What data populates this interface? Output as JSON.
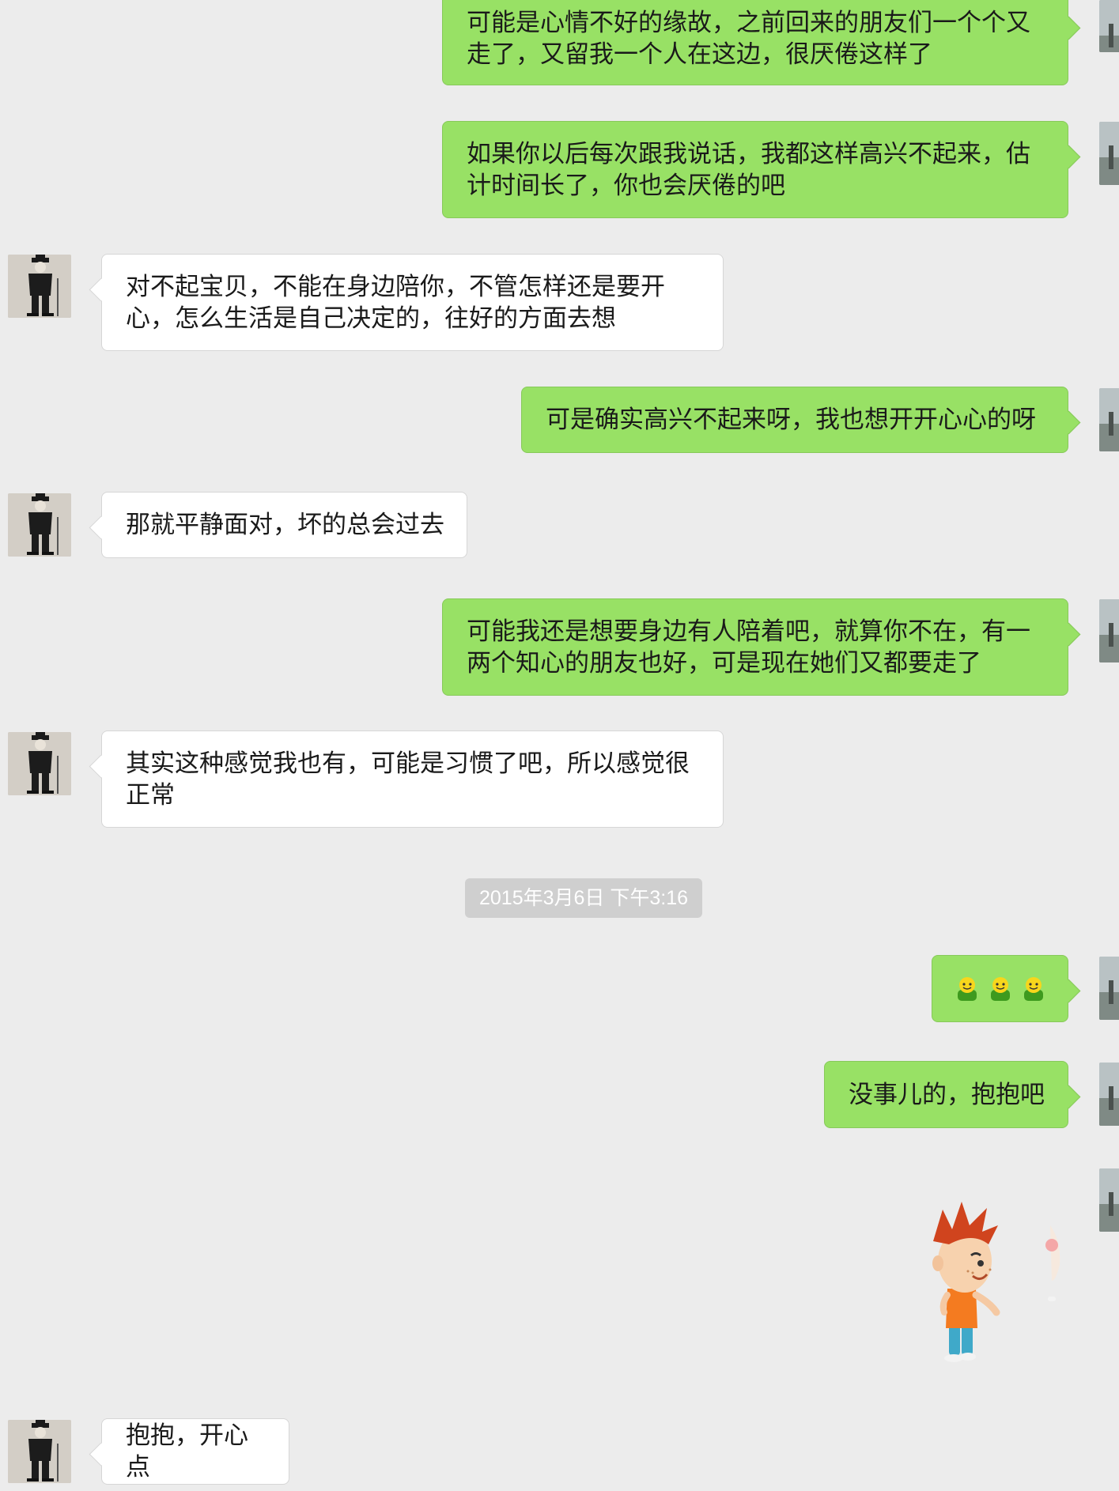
{
  "messages": [
    {
      "side": "right",
      "text": "可能是心情不好的缘故，之前回来的朋友们一个个又走了，又留我一个人在这边，很厌倦这样了"
    },
    {
      "side": "right",
      "text": "如果你以后每次跟我说话，我都这样高兴不起来，估计时间长了，你也会厌倦的吧"
    },
    {
      "side": "left",
      "text": "对不起宝贝，不能在身边陪你，不管怎样还是要开心，怎么生活是自己决定的，往好的方面去想"
    },
    {
      "side": "right",
      "text": "可是确实高兴不起来呀，我也想开开心心的呀"
    },
    {
      "side": "left",
      "text": "那就平静面对，坏的总会过去"
    },
    {
      "side": "right",
      "text": "可能我还是想要身边有人陪着吧，就算你不在，有一两个知心的朋友也好，可是现在她们又都要走了"
    },
    {
      "side": "left",
      "text": "其实这种感觉我也有，可能是习惯了吧，所以感觉很正常"
    },
    {
      "side": "right",
      "type": "emoji",
      "emoji": [
        "smiley-green-icon",
        "smiley-green-icon",
        "smiley-green-icon"
      ]
    },
    {
      "side": "right",
      "text": "没事儿的，抱抱吧"
    },
    {
      "side": "right",
      "type": "sticker",
      "sticker": "hug-cartoon-sticker"
    },
    {
      "side": "left",
      "text": "抱抱，开心点"
    }
  ],
  "timestamp": "2015年3月6日 下午3:16",
  "colors": {
    "background": "#ececec",
    "bubble_right": "#98e165",
    "bubble_left": "#ffffff",
    "timestamp_bg": "#cfcfcf"
  }
}
